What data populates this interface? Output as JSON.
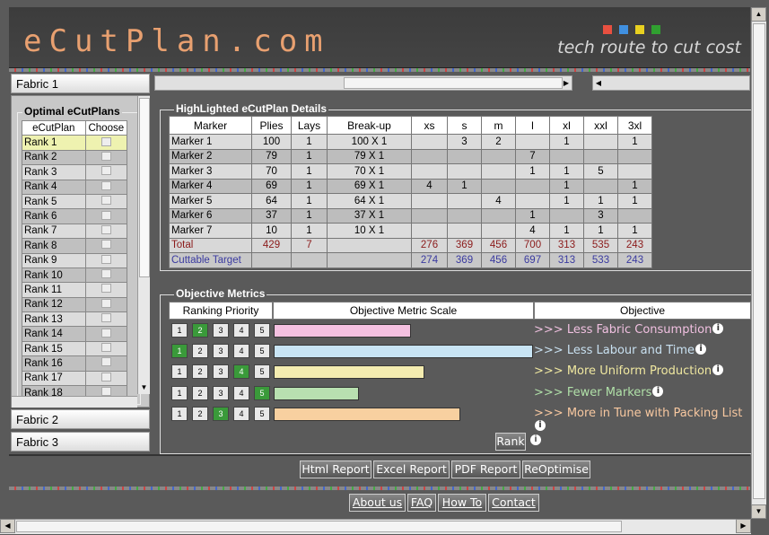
{
  "header": {
    "logo": "eCutPlan.com",
    "tagline": "tech route to cut cost",
    "brand_colors": [
      "#e85040",
      "#4090e0",
      "#e8d020",
      "#30a030"
    ]
  },
  "fabrics": [
    "Fabric 1",
    "Fabric 2",
    "Fabric 3"
  ],
  "optimal": {
    "legend": "Optimal eCutPlans",
    "col_plan": "eCutPlan",
    "col_choose": "Choose",
    "ranks": [
      "Rank 1",
      "Rank 2",
      "Rank 3",
      "Rank 4",
      "Rank 5",
      "Rank 6",
      "Rank 7",
      "Rank 8",
      "Rank 9",
      "Rank 10",
      "Rank 11",
      "Rank 12",
      "Rank 13",
      "Rank 14",
      "Rank 15",
      "Rank 16",
      "Rank 17",
      "Rank 18"
    ]
  },
  "details": {
    "legend": "HighLighted eCutPlan Details",
    "columns": [
      "Marker",
      "Plies",
      "Lays",
      "Break-up",
      "xs",
      "s",
      "m",
      "l",
      "xl",
      "xxl",
      "3xl"
    ],
    "rows": [
      [
        "Marker 1",
        "100",
        "1",
        "100 X 1",
        "",
        "3",
        "2",
        "",
        "1",
        "",
        "1"
      ],
      [
        "Marker 2",
        "79",
        "1",
        "79 X 1",
        "",
        "",
        "",
        "7",
        "",
        "",
        ""
      ],
      [
        "Marker 3",
        "70",
        "1",
        "70 X 1",
        "",
        "",
        "",
        "1",
        "1",
        "5",
        ""
      ],
      [
        "Marker 4",
        "69",
        "1",
        "69 X 1",
        "4",
        "1",
        "",
        "",
        "1",
        "",
        "1"
      ],
      [
        "Marker 5",
        "64",
        "1",
        "64 X 1",
        "",
        "",
        "4",
        "",
        "1",
        "1",
        "1"
      ],
      [
        "Marker 6",
        "37",
        "1",
        "37 X 1",
        "",
        "",
        "",
        "1",
        "",
        "3",
        ""
      ],
      [
        "Marker 7",
        "10",
        "1",
        "10 X 1",
        "",
        "",
        "",
        "4",
        "1",
        "1",
        "1"
      ]
    ],
    "total": [
      "Total",
      "429",
      "7",
      "",
      "276",
      "369",
      "456",
      "700",
      "313",
      "535",
      "243"
    ],
    "target": [
      "Cuttable Target",
      "",
      "",
      "",
      "274",
      "369",
      "456",
      "697",
      "313",
      "533",
      "243"
    ]
  },
  "metrics": {
    "legend": "Objective Metrics",
    "col_priority": "Ranking Priority",
    "col_scale": "Objective Metric Scale",
    "col_objective": "Objective",
    "priority_labels": [
      "1",
      "2",
      "3",
      "4",
      "5"
    ],
    "rows": [
      {
        "selected": 2,
        "scale": 0.53,
        "color": "#f4c0e0",
        "objective": "Less Fabric Consumption",
        "text_color": "#f0c0e0"
      },
      {
        "selected": 1,
        "scale": 1.0,
        "color": "#c8e4f4",
        "objective": "Less Labour and Time",
        "text_color": "#c8e0f0"
      },
      {
        "selected": 4,
        "scale": 0.58,
        "color": "#f4ecb0",
        "objective": "More Uniform Production",
        "text_color": "#f0e8a0"
      },
      {
        "selected": 5,
        "scale": 0.33,
        "color": "#b8e0b0",
        "objective": "Fewer Markers",
        "text_color": "#b0e0a8"
      },
      {
        "selected": 3,
        "scale": 0.72,
        "color": "#f8d0a0",
        "objective": "More in Tune with Packing List",
        "text_color": "#f8c8a0"
      }
    ],
    "arrow": ">>>",
    "rank_button": "Rank"
  },
  "actions": [
    "Html Report",
    "Excel Report",
    "PDF Report",
    "ReOptimise"
  ],
  "footer": [
    "About us",
    "FAQ",
    "How To",
    "Contact"
  ]
}
